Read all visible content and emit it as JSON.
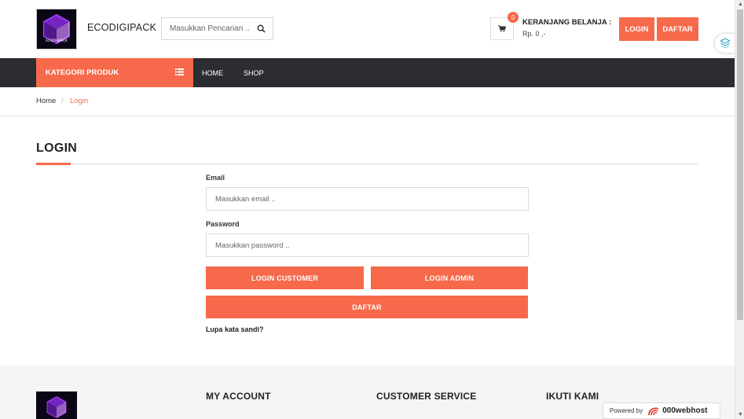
{
  "header": {
    "brand_name": "ECODIGIPACK",
    "logo_text": "ECODIGIPACK",
    "search_placeholder": "Masukkan Pencarian ..",
    "cart_count": "0",
    "cart_title": "KERANJANG BELANJA :",
    "cart_total": "Rp. 0 ,-",
    "login_label": "LOGIN",
    "daftar_label": "DAFTAR"
  },
  "nav": {
    "kategori_label": "KATEGORI PRODUK",
    "links": [
      "HOME",
      "SHOP"
    ]
  },
  "breadcrumb": {
    "home": "Home",
    "separator": "/",
    "current": "Login"
  },
  "login": {
    "title": "LOGIN",
    "email_label": "Email",
    "email_placeholder": "Masukkan email ..",
    "password_label": "Password",
    "password_placeholder": "Masukkan password ..",
    "btn_customer": "LOGIN CUSTOMER",
    "btn_admin": "LOGIN ADMIN",
    "btn_daftar": "DAFTAR",
    "forgot": "Lupa kata sandi?"
  },
  "footer": {
    "headings": [
      "MY ACCOUNT",
      "CUSTOMER SERVICE",
      "IKUTI KAMI"
    ]
  },
  "powered": {
    "prefix": "Powered by",
    "host": "000webhost"
  },
  "colors": {
    "accent": "#f6694a",
    "nav_bg": "#2b2d33",
    "footer_bg": "#f5f5f6"
  },
  "icons": {
    "search": "search-icon",
    "cart": "cart-icon",
    "menu": "list-icon",
    "logo": "cube-logo-icon",
    "widget": "layers-icon"
  }
}
